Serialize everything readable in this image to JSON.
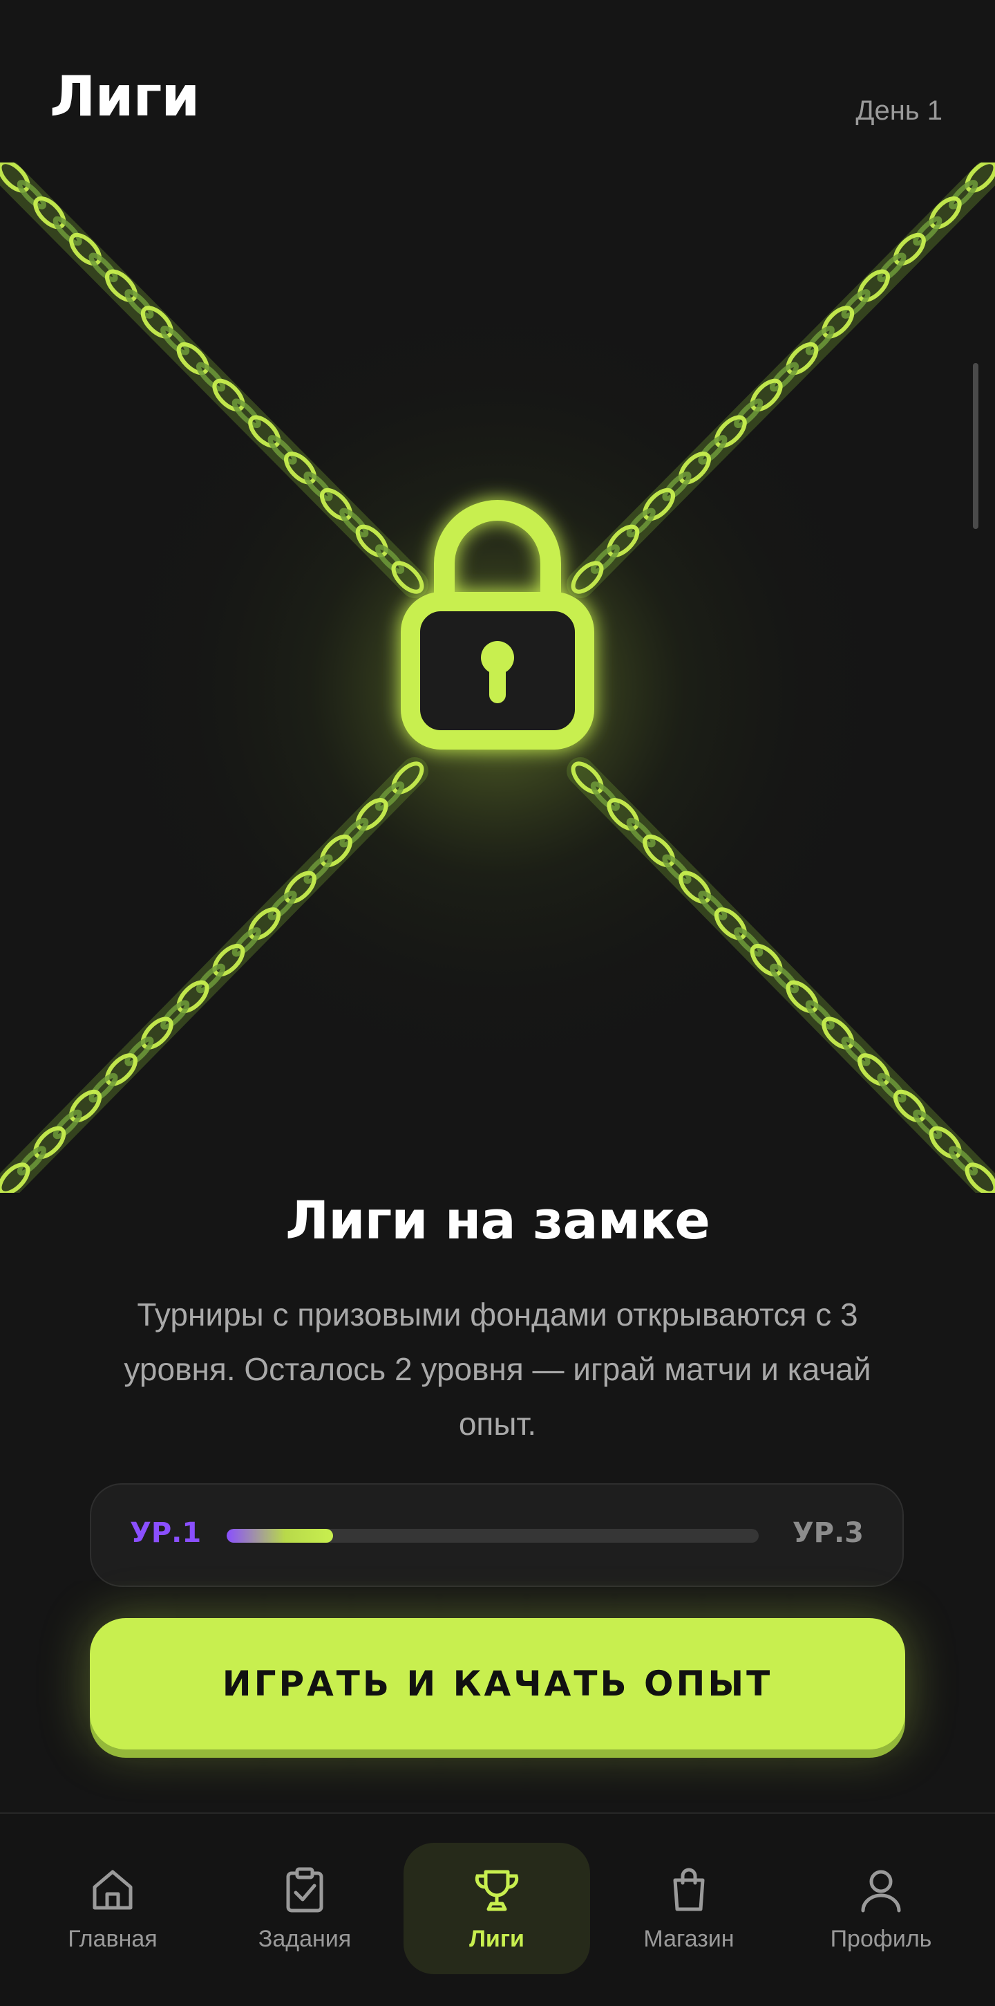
{
  "header": {
    "title": "Лиги",
    "day": "День 1"
  },
  "locked": {
    "headline": "Лиги на замке",
    "description": "Турниры с призовыми фондами открываются с 3 уровня. Осталось 2 уровня — играй матчи и качай опыт."
  },
  "level_progress": {
    "start_label": "УР.1",
    "end_label": "УР.3",
    "progress_fraction": 0.2
  },
  "cta": {
    "label": "ИГРАТЬ И КАЧАТЬ ОПЫТ"
  },
  "tabbar": {
    "items": [
      {
        "label": "Главная",
        "icon": "home-icon",
        "active": false
      },
      {
        "label": "Задания",
        "icon": "clipboard-check-icon",
        "active": false
      },
      {
        "label": "Лиги",
        "icon": "trophy-icon",
        "active": true
      },
      {
        "label": "Магазин",
        "icon": "shopping-bag-icon",
        "active": false
      },
      {
        "label": "Профиль",
        "icon": "user-icon",
        "active": false
      }
    ]
  },
  "colors": {
    "background": "#151515",
    "accent": "#c8ef4f",
    "level_start": "#8a4fff",
    "muted_text": "#9a9a9a"
  }
}
